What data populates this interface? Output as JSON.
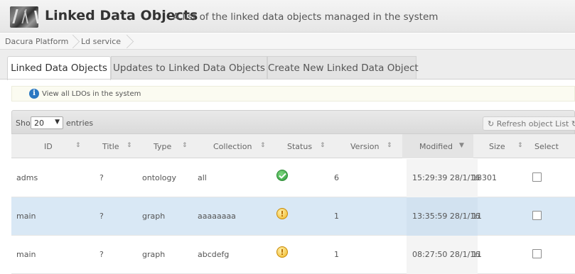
{
  "header": {
    "title": "Linked Data Objects",
    "subtitle": "A list of the linked data objects managed in the system"
  },
  "breadcrumb": [
    "Dacura Platform",
    "Ld service"
  ],
  "tabs": [
    {
      "label": "Linked Data Objects",
      "active": true
    },
    {
      "label": "Updates to Linked Data Objects",
      "active": false
    },
    {
      "label": "Create New Linked Data Object",
      "active": false
    }
  ],
  "info": {
    "text": "View all LDOs in the system",
    "icon": "info-icon"
  },
  "toolbar": {
    "show_label": "Show",
    "length_value": "20",
    "entries_label": "entries",
    "refresh_label": "↻ Refresh object List ↻"
  },
  "table": {
    "columns": [
      "ID",
      "Title",
      "Type",
      "Collection",
      "Status",
      "Version",
      "Modified",
      "Size",
      "Select"
    ],
    "sorted_column": "Modified",
    "rows": [
      {
        "id": "adms",
        "title": "?",
        "type": "ontology",
        "collection": "all",
        "status": "accept",
        "version": "6",
        "modified": "15:29:39 28/1/16",
        "size": "18301",
        "selected": false
      },
      {
        "id": "main",
        "title": "?",
        "type": "graph",
        "collection": "aaaaaaaa",
        "status": "pending",
        "version": "1",
        "modified": "13:35:59 28/1/16",
        "size": "11",
        "selected": false,
        "highlighted": true
      },
      {
        "id": "main",
        "title": "?",
        "type": "graph",
        "collection": "abcdefg",
        "status": "pending",
        "version": "1",
        "modified": "08:27:50 28/1/16",
        "size": "11",
        "selected": false
      }
    ]
  },
  "colors": {
    "accent": "#2b78c2",
    "status_ok": "#2e9a3a",
    "status_warn": "#f0b41c",
    "selected_row": "#d9e8f5"
  }
}
